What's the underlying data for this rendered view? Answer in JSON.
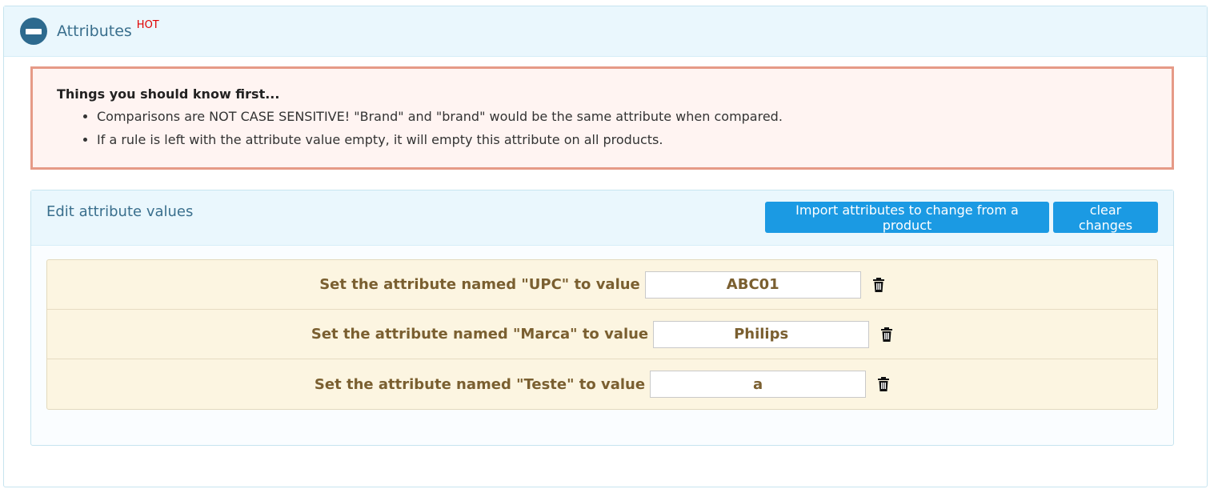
{
  "panel": {
    "title": "Attributes",
    "badge": "HOT"
  },
  "alert": {
    "title": "Things you should know first...",
    "items": [
      "Comparisons are NOT CASE SENSITIVE! \"Brand\" and \"brand\" would be the same attribute when compared.",
      "If a rule is left with the attribute value empty, it will empty this attribute on all products."
    ]
  },
  "edit": {
    "title": "Edit attribute values",
    "import_button": "Import attributes to change from a product",
    "clear_button": "clear changes",
    "rules": [
      {
        "label": "Set the attribute named \"UPC\" to value",
        "value": "ABC01"
      },
      {
        "label": "Set the attribute named \"Marca\" to value",
        "value": "Philips"
      },
      {
        "label": "Set the attribute named \"Teste\" to value",
        "value": "a"
      }
    ]
  },
  "icons": {
    "collapse": "minus-circle-icon",
    "delete": "trash-icon"
  },
  "colors": {
    "accent": "#1b9ae3",
    "hot": "#e00000",
    "alert_border": "#e69a87"
  }
}
